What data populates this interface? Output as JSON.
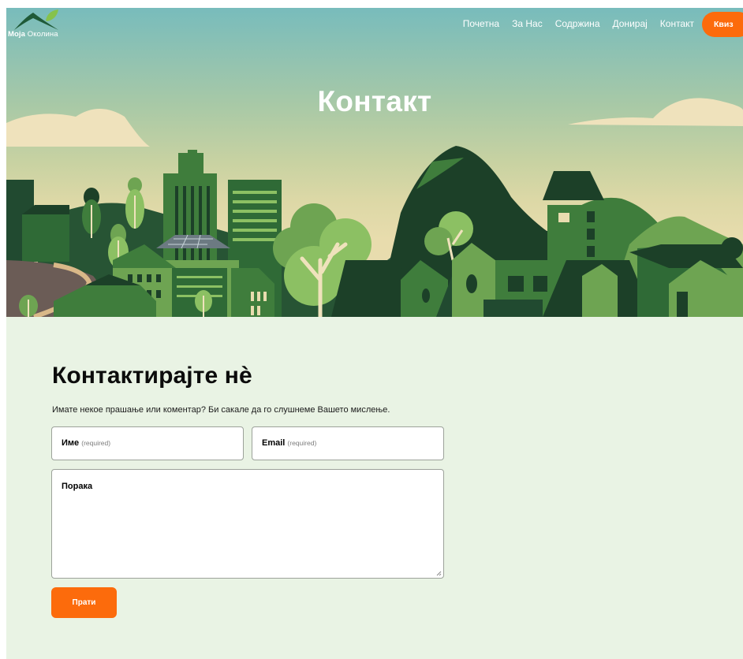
{
  "header": {
    "logo": {
      "name": "Моја",
      "tagline": "Околина"
    },
    "nav": [
      "Почетна",
      "За Нас",
      "Содржина",
      "Донирај",
      "Контакт"
    ],
    "quiz_button": "Квиз",
    "hero_title": "Контакт"
  },
  "contact": {
    "heading": "Контактирајте нѐ",
    "subtitle": "Имате некое прашање или коментар? Би сакале да го слушнеме Вашето мислење.",
    "name_label": "Име",
    "name_required": "(required)",
    "email_label": "Email",
    "email_required": "(required)",
    "message_label": "Порака",
    "send_button": "Прати"
  },
  "colors": {
    "accent": "#fc6b0c",
    "page_background": "#e9f3e4",
    "sky_top": "#78bcbc",
    "sky_bottom": "#e9dcaf",
    "dark_green": "#1c4028",
    "mid_green": "#3f7d3c",
    "light_green": "#6ea452"
  }
}
